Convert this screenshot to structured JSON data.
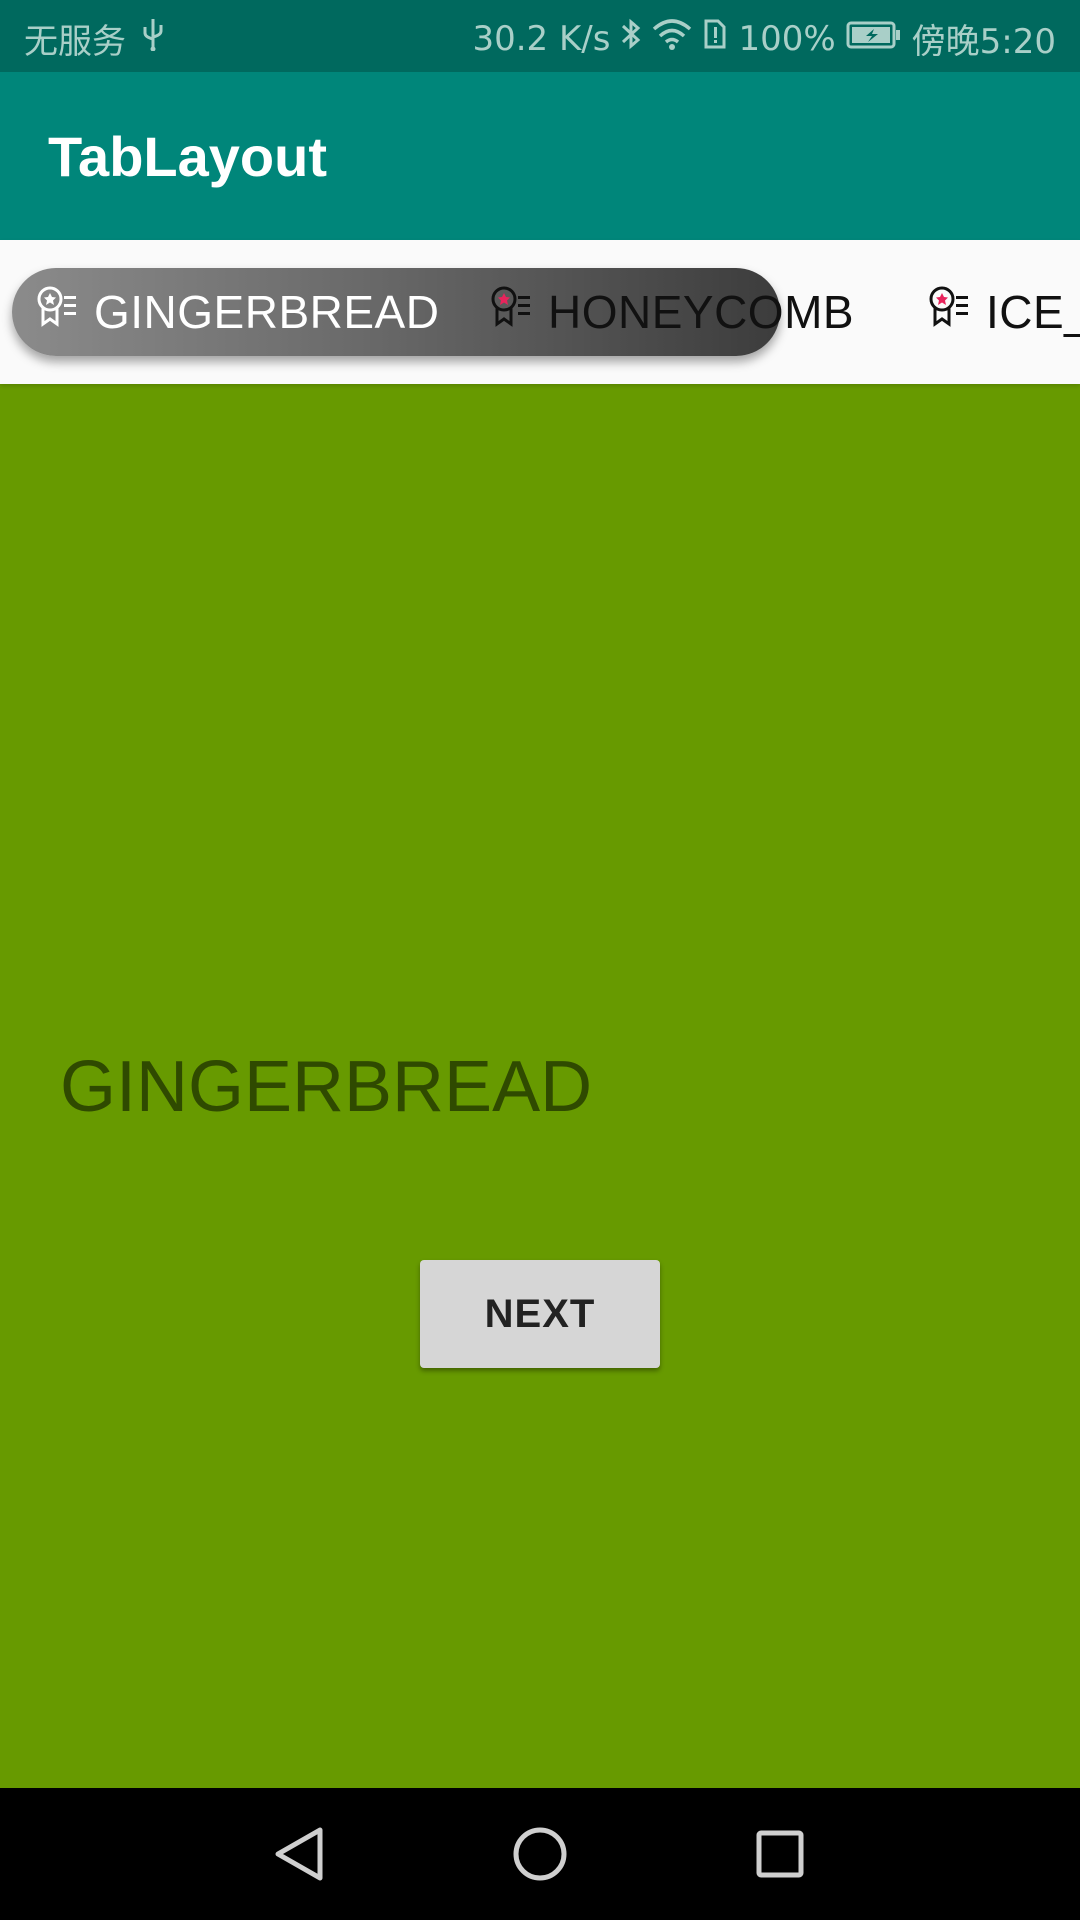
{
  "status_bar": {
    "carrier": "无服务",
    "network_speed": "30.2 K/s",
    "battery": "100%",
    "time": "傍晚5:20",
    "icons": [
      "usb-icon",
      "bluetooth-icon",
      "wifi-icon",
      "sim-alert-icon",
      "battery-charging-icon"
    ]
  },
  "app_bar": {
    "title": "TabLayout"
  },
  "tabs": [
    {
      "label": "GINGERBREAD",
      "icon": "badge-icon",
      "selected": true
    },
    {
      "label": "HONEYCOMB",
      "icon": "badge-icon",
      "selected": false
    },
    {
      "label": "ICE_",
      "icon": "badge-icon",
      "selected": false
    }
  ],
  "content": {
    "label": "GINGERBREAD",
    "next_button_label": "NEXT",
    "background_color": "#679a00"
  },
  "navigation": {
    "icons": [
      "back-icon",
      "home-icon",
      "recent-apps-icon"
    ]
  }
}
